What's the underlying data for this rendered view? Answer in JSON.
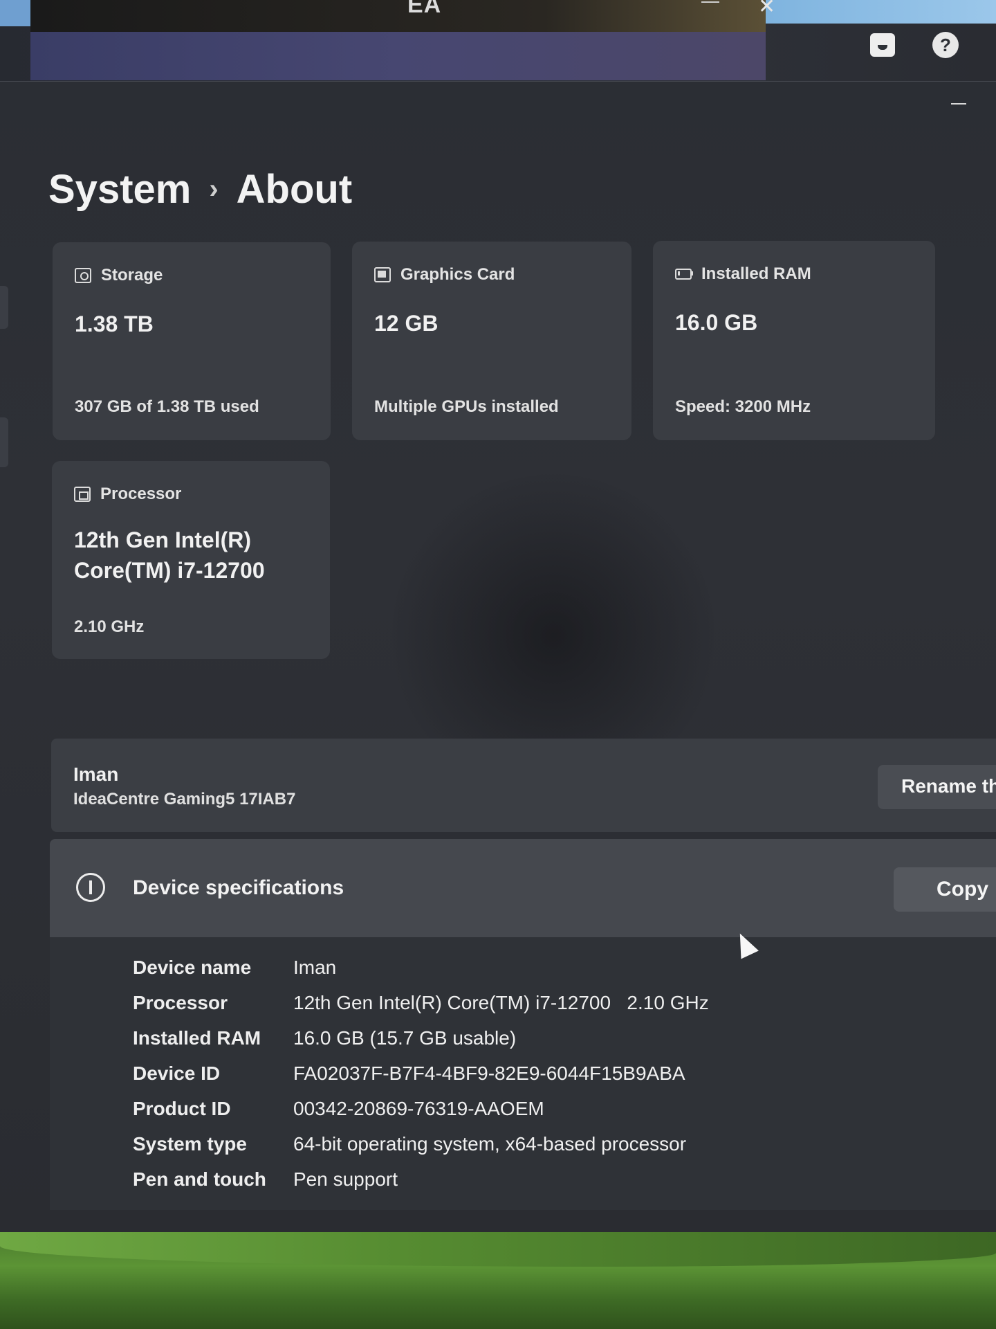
{
  "background_app": {
    "title": "EA"
  },
  "page": {
    "breadcrumb_parent": "System",
    "breadcrumb_separator": "›",
    "breadcrumb_current": "About"
  },
  "cards": {
    "storage": {
      "title": "Storage",
      "value": "1.38 TB",
      "sub": "307 GB of 1.38 TB used",
      "icon": "storage-icon"
    },
    "graphics": {
      "title": "Graphics Card",
      "value": "12 GB",
      "sub": "Multiple GPUs installed",
      "icon": "graphics-card-icon"
    },
    "ram": {
      "title": "Installed RAM",
      "value": "16.0 GB",
      "sub": "Speed: 3200 MHz",
      "icon": "memory-icon"
    },
    "processor": {
      "title": "Processor",
      "value_line1": "12th Gen Intel(R)",
      "value_line2": "Core(TM) i7-12700",
      "sub": "2.10 GHz",
      "icon": "processor-icon"
    }
  },
  "device": {
    "name": "Iman",
    "model": "IdeaCentre Gaming5 17IAB7",
    "rename_label": "Rename th"
  },
  "specs": {
    "title": "Device specifications",
    "copy_label": "Copy",
    "rows": [
      {
        "label": "Device name",
        "value": "Iman"
      },
      {
        "label": "Processor",
        "value": "12th Gen Intel(R) Core(TM) i7-12700   2.10 GHz"
      },
      {
        "label": "Installed RAM",
        "value": "16.0 GB (15.7 GB usable)"
      },
      {
        "label": "Device ID",
        "value": "FA02037F-B7F4-4BF9-82E9-6044F15B9ABA"
      },
      {
        "label": "Product ID",
        "value": "00342-20869-76319-AAOEM"
      },
      {
        "label": "System type",
        "value": "64-bit operating system, x64-based processor"
      },
      {
        "label": "Pen and touch",
        "value": "Pen support"
      }
    ]
  },
  "colors": {
    "card_bg": "#3a3d43",
    "window_bg": "#2b2e34",
    "spec_header_bg": "#45484e"
  }
}
